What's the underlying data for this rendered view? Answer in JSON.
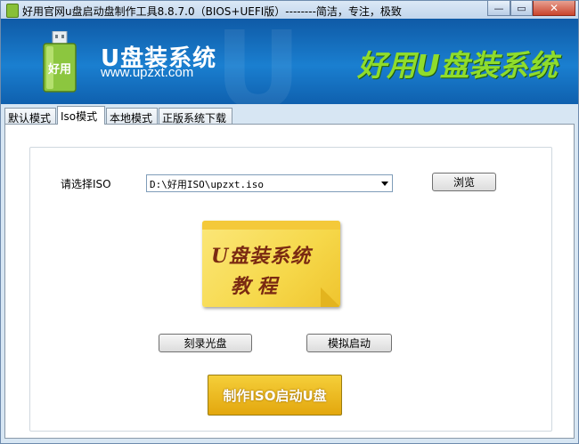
{
  "window": {
    "title": "好用官网u盘启动盘制作工具8.8.7.0（BIOS+UEFI版）--------简洁，专注，极致",
    "minimize_glyph": "—",
    "maximize_glyph": "▭",
    "close_glyph": "✕"
  },
  "banner": {
    "brand_name": "U盘装系统",
    "url": "www.upzxt.com",
    "slogan": "好用U盘装系统",
    "logo_text": "好用",
    "logo_icon": "usb-drive-icon",
    "slogan_color": "#8fdc2c"
  },
  "tabs": [
    {
      "label": "默认模式",
      "active": false
    },
    {
      "label": "Iso模式",
      "active": true
    },
    {
      "label": "本地模式",
      "active": false
    },
    {
      "label": "正版系统下载",
      "active": false
    }
  ],
  "iso_mode": {
    "select_label": "请选择ISO",
    "selected_path": "D:\\好用ISO\\upzxt.iso",
    "browse_label": "浏览",
    "tutorial_line1": "U盘装系统",
    "tutorial_line2": "教程",
    "burn_cd_label": "刻录光盘",
    "simulate_boot_label": "模拟启动",
    "make_iso_usb_label": "制作ISO启动U盘"
  }
}
